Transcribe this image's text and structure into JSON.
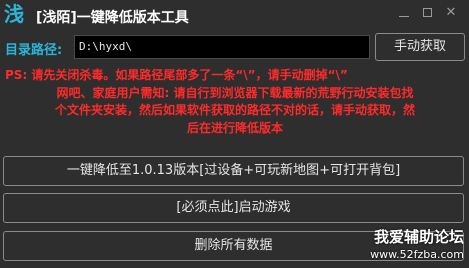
{
  "window": {
    "logo_glyph": "浅",
    "title": "[浅陌]一键降低版本工具",
    "minimize_glyph": "—",
    "maximize_glyph": "□",
    "close_glyph": "✕"
  },
  "path_row": {
    "label": "目录路径:",
    "input_value": "D:\\hyxd\\",
    "manual_button_label": "手动获取"
  },
  "notice": {
    "line1": "PS: 请先关闭杀毒。如果路径尾部多了一条“\\”，请手动删掉“\\”",
    "line2": "网吧、家庭用户需知: 请自行到浏览器下载最新的荒野行动安装包找",
    "line3": "个文件夹安装，然后如果软件获取的路径不对的话，请手动获取，然",
    "line4": "后在进行降低版本",
    "color": "#ff2a2a"
  },
  "actions": {
    "downgrade_label": "一键降低至1.0.13版本[过设备+可玩新地图+可打开背包]",
    "launch_label": "[必须点此]启动游戏",
    "delete_label": "删除所有数据"
  },
  "watermark": {
    "title": "我爱辅助论坛",
    "url": "www.52fzba.com"
  },
  "colors": {
    "accent": "#29b6d8",
    "background": "#2e2e2e",
    "input_background": "#000000"
  }
}
